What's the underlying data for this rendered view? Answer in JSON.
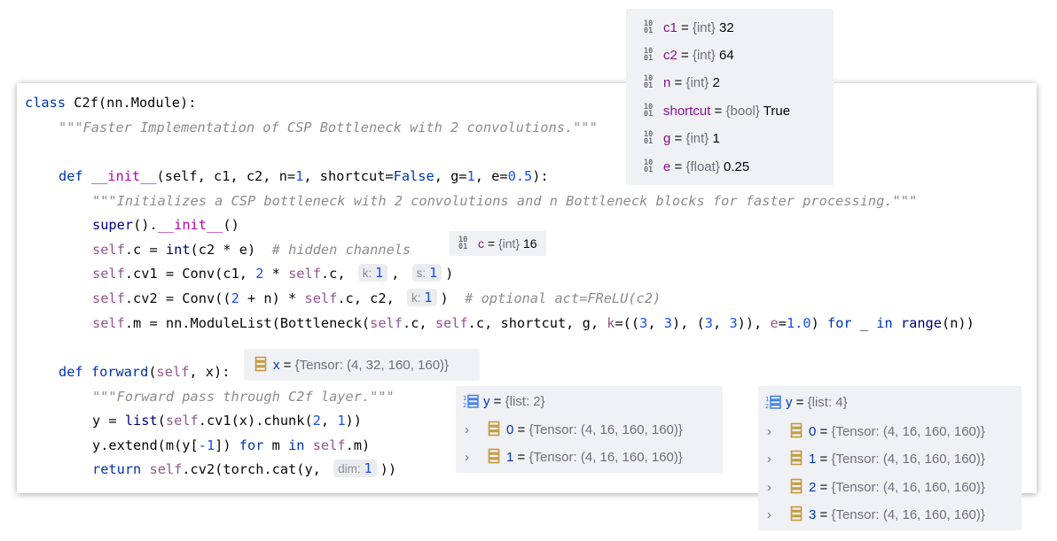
{
  "code": {
    "class_kw": "class",
    "class_decl": " C2f(nn.Module):",
    "class_doc": "\"\"\"Faster Implementation of CSP Bottleneck with 2 convolutions.\"\"\"",
    "def_kw": "def",
    "init_name": "__init__",
    "init_params_1": "(self, c1, c2, n=",
    "init_n": "1",
    "init_params_2": ", shortcut=",
    "init_false": "False",
    "init_params_3": ", g=",
    "init_g": "1",
    "init_params_4": ", e=",
    "init_e": "0.5",
    "init_params_5": "):",
    "init_doc": "\"\"\"Initializes a CSP bottleneck with 2 convolutions and n Bottleneck blocks for faster processing.\"\"\"",
    "super_name": "super",
    "super_rest": "().",
    "super_init": "__init__",
    "super_end": "()",
    "self_kw": "self",
    "line_c_a": ".c = ",
    "int_fn": "int",
    "line_c_b": "(c2 * e)  ",
    "line_c_cmt": "# hidden channels",
    "line_cv1_a": ".cv1 = Conv(c1, ",
    "line_cv1_two": "2",
    "line_cv1_b": " * ",
    "line_cv1_c": ".c, ",
    "hint_k": "k:",
    "hint_k_val": "1",
    "line_cv1_d": ", ",
    "hint_s": "s:",
    "hint_s_val": "1",
    "line_cv1_e": ")",
    "line_cv2_a": ".cv2 = Conv((",
    "line_cv2_two": "2",
    "line_cv2_b": " + n) * ",
    "line_cv2_c": ".c, c2, ",
    "line_cv2_d": ")  ",
    "line_cv2_cmt": "# optional act=FReLU(c2)",
    "line_m_a": ".m = nn.ModuleList(Bottleneck(",
    "line_m_b": ".c, ",
    "line_m_c": ".c, shortcut, g, ",
    "line_m_k": "k",
    "line_m_d": "=((",
    "three": "3",
    "comma_sp": ", ",
    "line_m_e": "), (",
    "line_m_f": ")), ",
    "line_m_e_kw": "e",
    "line_m_eq": "=",
    "one_zero": "1.0",
    "line_m_g": ") ",
    "for_kw": "for",
    "line_m_h": " _ ",
    "in_kw": "in",
    "line_m_sp": " ",
    "range_fn": "range",
    "line_m_end": "(n))",
    "forward_name": "forward",
    "forward_params_a": "(",
    "forward_params_b": ", x):",
    "forward_doc": "\"\"\"Forward pass through C2f layer.\"\"\"",
    "y_line_a": "y = ",
    "list_fn": "list",
    "y_line_b": "(",
    "y_line_c": ".cv1(x).chunk(",
    "y_line_two": "2",
    "y_line_d": ", ",
    "y_line_one": "1",
    "y_line_e": "))",
    "ext_a": "y.extend(m(y[",
    "ext_neg1": "-1",
    "ext_b": "]) ",
    "ext_c": " m ",
    "ext_d": ".m)",
    "return_kw": "return",
    "ret_a": " ",
    "ret_b": ".cv2(torch.cat(y, ",
    "hint_dim": "dim:",
    "hint_dim_val": "1",
    "ret_c": "))"
  },
  "debug_vars_top": [
    {
      "name": "c1",
      "eq": " = ",
      "type": "{int}",
      "value": " 32"
    },
    {
      "name": "c2",
      "eq": " = ",
      "type": "{int}",
      "value": " 64"
    },
    {
      "name": "n",
      "eq": " = ",
      "type": "{int}",
      "value": " 2"
    },
    {
      "name": "shortcut",
      "eq": " = ",
      "type": "{bool}",
      "value": " True"
    },
    {
      "name": "g",
      "eq": " = ",
      "type": "{int}",
      "value": " 1"
    },
    {
      "name": "e",
      "eq": " = ",
      "type": "{float}",
      "value": " 0.25"
    }
  ],
  "debug_c": {
    "name": "c",
    "eq": " = ",
    "type": "{int}",
    "value": " 16"
  },
  "debug_x": {
    "name": "x",
    "eq": " = ",
    "type": "{Tensor: (4, 32, 160, 160)}"
  },
  "debug_y_mid": {
    "name": "y",
    "eq": " = ",
    "type": "{list: 2}",
    "items": [
      {
        "index": "0",
        "eq": " = ",
        "type": "{Tensor: (4, 16, 160, 160)}"
      },
      {
        "index": "1",
        "eq": " = ",
        "type": "{Tensor: (4, 16, 160, 160)}"
      }
    ]
  },
  "debug_y_right": {
    "name": "y",
    "eq": " = ",
    "type": "{list: 4}",
    "items": [
      {
        "index": "0",
        "eq": " = ",
        "type": "{Tensor: (4, 16, 160, 160)}"
      },
      {
        "index": "1",
        "eq": " = ",
        "type": "{Tensor: (4, 16, 160, 160)}"
      },
      {
        "index": "2",
        "eq": " = ",
        "type": "{Tensor: (4, 16, 160, 160)}"
      },
      {
        "index": "3",
        "eq": " = ",
        "type": "{Tensor: (4, 16, 160, 160)}"
      }
    ]
  },
  "icons": {
    "primitive": "primitive-value-icon",
    "tensor": "tensor-stack-icon",
    "list": "list-icon",
    "expand": "chevron-right-icon"
  },
  "icon_text": {
    "prim_top": "10",
    "prim_bottom": "01",
    "chevron": "›"
  },
  "colors": {
    "keyword": "#0033b3",
    "dunder": "#b200b2",
    "self": "#94558d",
    "number": "#1750eb",
    "comment": "#8c8c8c",
    "var_name": "#871094",
    "tensor_icon": "#c49a3c"
  }
}
